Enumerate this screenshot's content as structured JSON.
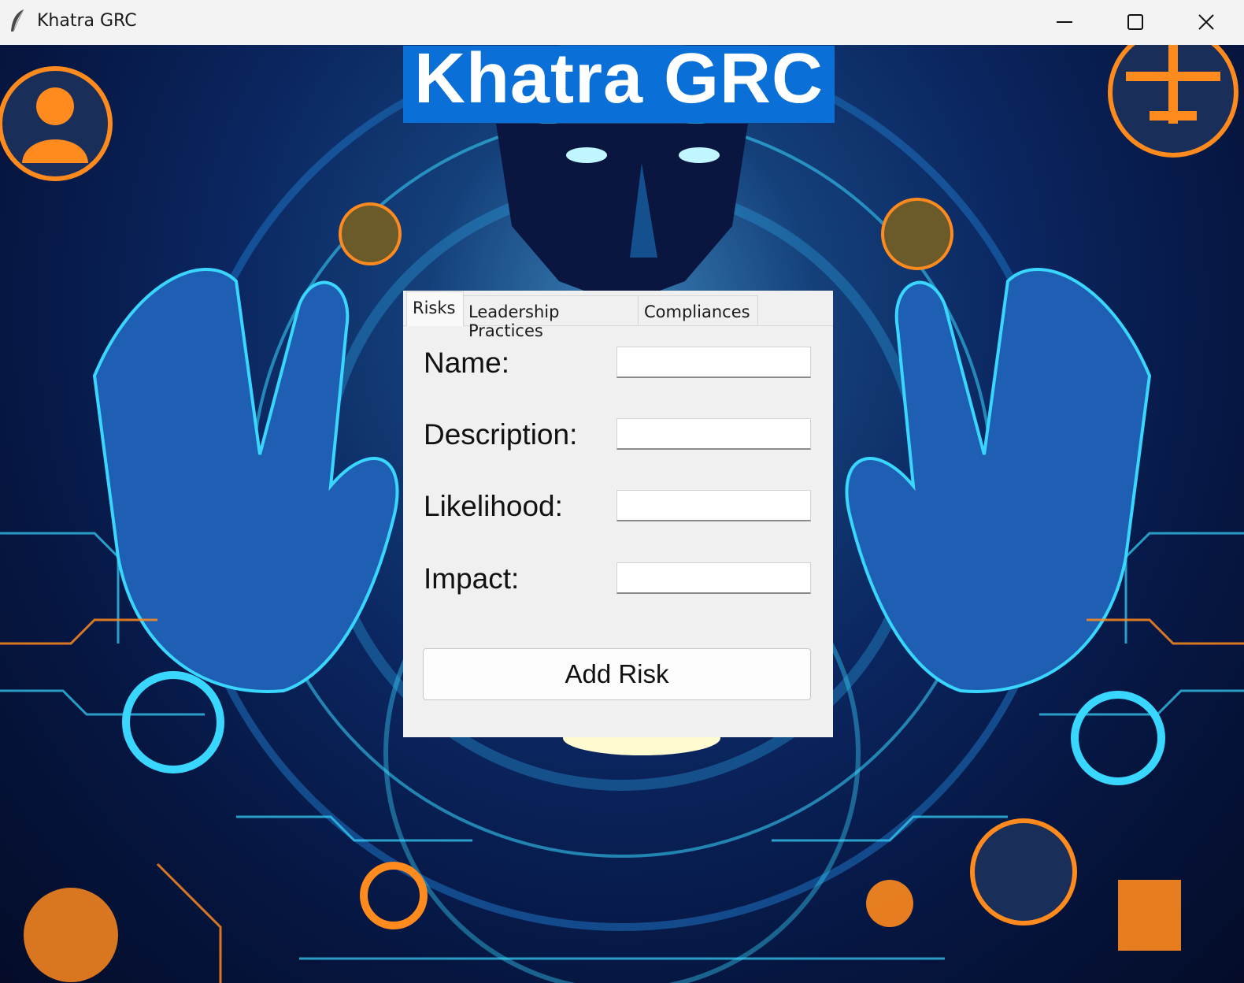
{
  "window": {
    "app_icon": "feather-icon",
    "title": "Khatra GRC",
    "controls": [
      "minimize-icon",
      "maximize-icon",
      "close-icon"
    ]
  },
  "banner": {
    "text": "Khatra GRC",
    "background": "#0a6fd6",
    "color": "#ffffff"
  },
  "tabs": [
    {
      "label": "Risks",
      "active": true
    },
    {
      "label": "Leadership Practices",
      "active": false
    },
    {
      "label": "Compliances",
      "active": false
    }
  ],
  "form": {
    "fields": [
      {
        "label": "Name:",
        "value": ""
      },
      {
        "label": "Description:",
        "value": ""
      },
      {
        "label": "Likelihood:",
        "value": ""
      },
      {
        "label": "Impact:",
        "value": ""
      }
    ],
    "submit_label": "Add Risk"
  },
  "colors": {
    "accent_orange": "#ff8a1e",
    "neon_cyan": "#39d7ff",
    "panel_bg": "#f0f0f0"
  }
}
